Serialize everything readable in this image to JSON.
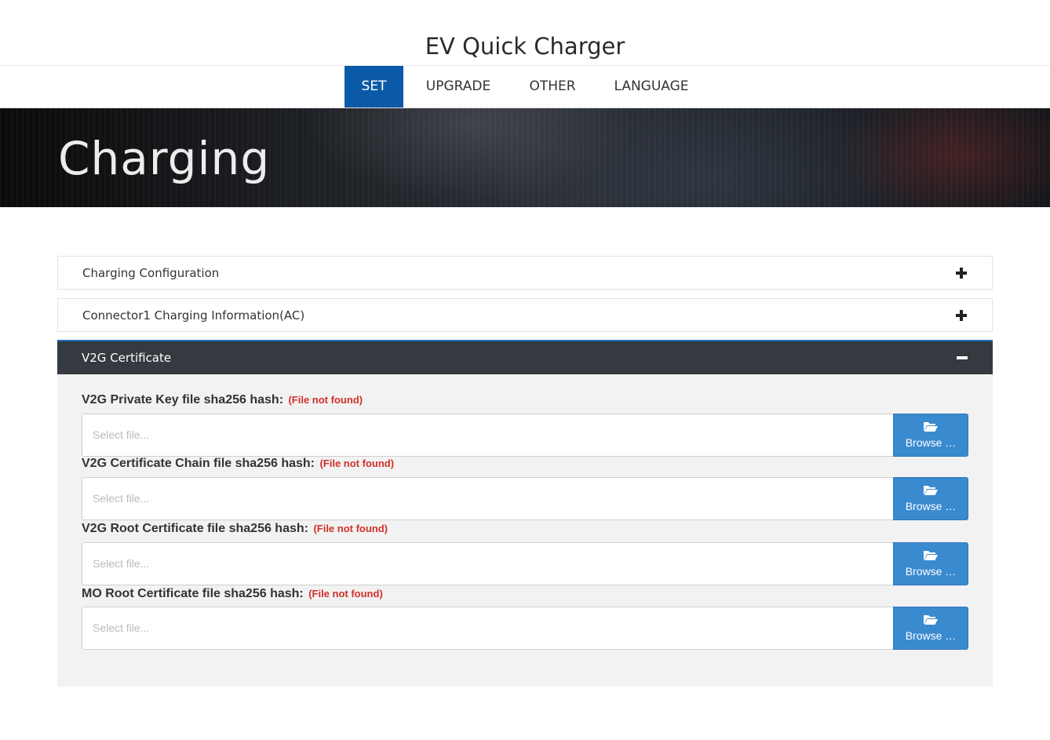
{
  "app": {
    "title": "EV Quick Charger"
  },
  "nav": {
    "tabs": [
      {
        "label": "SET",
        "active": true
      },
      {
        "label": "UPGRADE"
      },
      {
        "label": "OTHER"
      },
      {
        "label": "LANGUAGE"
      }
    ]
  },
  "banner": {
    "title": "Charging"
  },
  "panels": [
    {
      "label": "Charging Configuration",
      "state": "collapsed",
      "icon": "plus-icon"
    },
    {
      "label": "Connector1 Charging Information(AC)",
      "state": "collapsed",
      "icon": "plus-icon"
    },
    {
      "label": "V2G Certificate",
      "state": "expanded",
      "icon": "minus-icon"
    }
  ],
  "certificates": [
    {
      "label": "V2G Private Key file sha256 hash:",
      "status": "(File not found)",
      "placeholder": "Select file...",
      "button": "Browse …"
    },
    {
      "label": "V2G Certificate Chain file sha256 hash:",
      "status": "(File not found)",
      "placeholder": "Select file...",
      "button": "Browse …"
    },
    {
      "label": "V2G Root Certificate file sha256 hash:",
      "status": "(File not found)",
      "placeholder": "Select file...",
      "button": "Browse …"
    },
    {
      "label": "MO Root Certificate file sha256 hash:",
      "status": "(File not found)",
      "placeholder": "Select file...",
      "button": "Browse …"
    }
  ],
  "colors": {
    "nav_active": "#0a5aa8",
    "panel_dark": "#343a40",
    "browse": "#3a8ad0",
    "error": "#d0302a"
  }
}
